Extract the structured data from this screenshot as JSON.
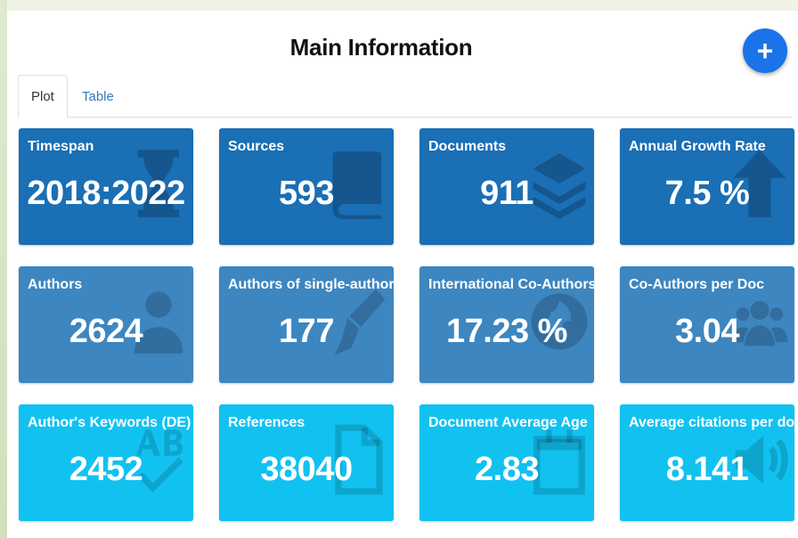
{
  "header": {
    "title": "Main Information",
    "add_button_label": "+"
  },
  "tabs": [
    {
      "label": "Plot",
      "active": true
    },
    {
      "label": "Table",
      "active": false
    }
  ],
  "colors": {
    "row1": "#1a6fb5",
    "row2": "#3d86c0",
    "row3": "#11c2f1",
    "fab": "#1a73e8"
  },
  "cards": [
    {
      "label": "Timespan",
      "value": "2018:2022",
      "icon": "hourglass-icon"
    },
    {
      "label": "Sources",
      "value": "593",
      "icon": "book-icon"
    },
    {
      "label": "Documents",
      "value": "911",
      "icon": "layers-icon"
    },
    {
      "label": "Annual Growth Rate",
      "value": "7.5 %",
      "icon": "arrow-up-icon"
    },
    {
      "label": "Authors",
      "value": "2624",
      "icon": "user-icon"
    },
    {
      "label": "Authors of single-authored Docs",
      "value": "177",
      "icon": "pen-icon"
    },
    {
      "label": "International Co-Authorship",
      "value": "17.23 %",
      "icon": "globe-icon"
    },
    {
      "label": "Co-Authors per Doc",
      "value": "3.04",
      "icon": "users-icon"
    },
    {
      "label": "Author's Keywords (DE)",
      "value": "2452",
      "icon": "spell-check-icon"
    },
    {
      "label": "References",
      "value": "38040",
      "icon": "file-icon"
    },
    {
      "label": "Document Average Age",
      "value": "2.83",
      "icon": "calendar-icon"
    },
    {
      "label": "Average citations per doc",
      "value": "8.141",
      "icon": "volume-icon"
    }
  ]
}
